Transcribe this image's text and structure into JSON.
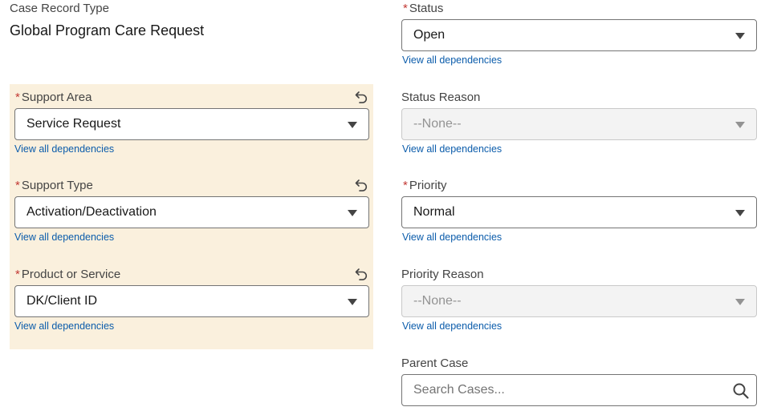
{
  "case_record_type": {
    "label": "Case Record Type",
    "value": "Global Program Care Request"
  },
  "required_marker": "*",
  "dependency_link_text": "View all dependencies",
  "fields": {
    "support_area": {
      "label": "Support Area",
      "value": "Service Request"
    },
    "support_type": {
      "label": "Support Type",
      "value": "Activation/Deactivation"
    },
    "product_or_service": {
      "label": "Product or Service",
      "value": "DK/Client ID"
    },
    "status": {
      "label": "Status",
      "value": "Open"
    },
    "status_reason": {
      "label": "Status Reason",
      "value": "--None--"
    },
    "priority": {
      "label": "Priority",
      "value": "Normal"
    },
    "priority_reason": {
      "label": "Priority Reason",
      "value": "--None--"
    },
    "parent_case": {
      "label": "Parent Case",
      "placeholder": "Search Cases..."
    }
  },
  "icons": {
    "undo": "undo-icon",
    "dropdown": "chevron-down-icon",
    "search": "search-icon"
  },
  "colors": {
    "required": "#c23934",
    "link": "#0b5cab",
    "panel_highlight": "#faf0dd",
    "border": "#747474",
    "disabled_bg": "#f3f3f3"
  }
}
